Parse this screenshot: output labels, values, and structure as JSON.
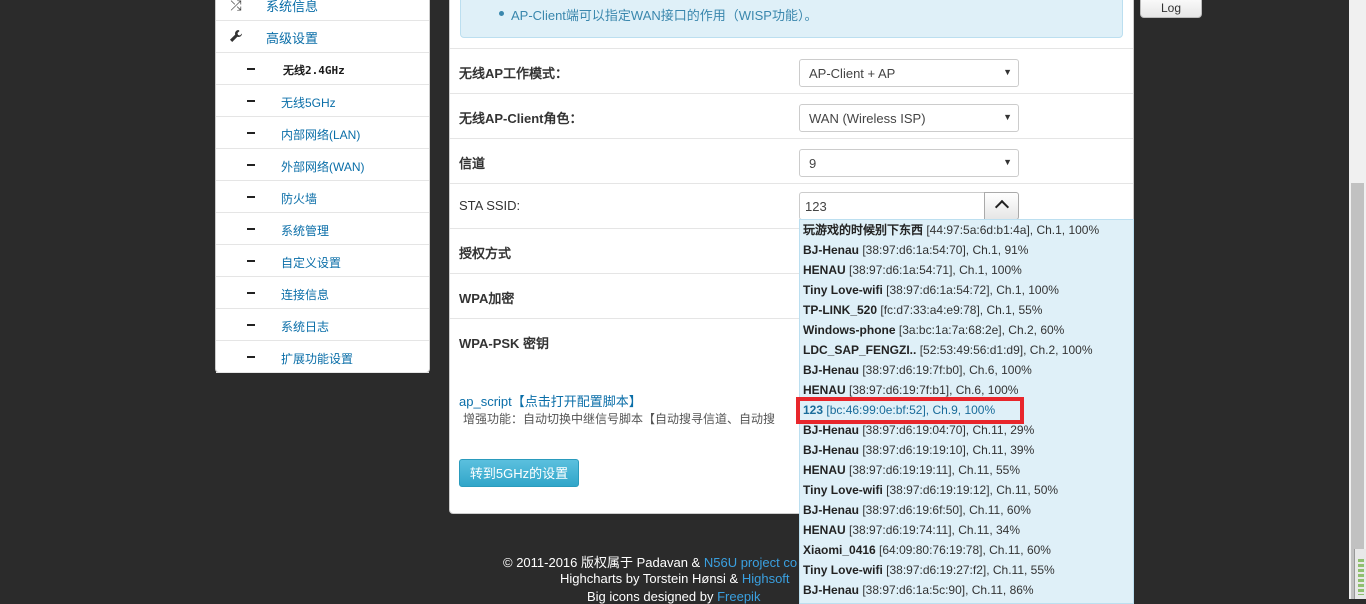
{
  "sidebar": {
    "top_items": [
      {
        "label": "系统信息",
        "icon": "shuffle-icon"
      },
      {
        "label": "高级设置",
        "icon": "wrench-icon"
      }
    ],
    "sub_items": [
      {
        "label": "无线2.4GHz",
        "active": true
      },
      {
        "label": "无线5GHz"
      },
      {
        "label": "内部网络(LAN)"
      },
      {
        "label": "外部网络(WAN)"
      },
      {
        "label": "防火墙"
      },
      {
        "label": "系统管理"
      },
      {
        "label": "自定义设置"
      },
      {
        "label": "连接信息"
      },
      {
        "label": "系统日志"
      },
      {
        "label": "扩展功能设置"
      }
    ]
  },
  "info": {
    "text": "AP-Client端可以指定WAN接口的作用（WISP功能）。"
  },
  "form": {
    "ap_mode": {
      "label": "无线AP工作模式：",
      "value": "AP-Client + AP"
    },
    "ap_client_role": {
      "label": "无线AP-Client角色：",
      "value": "WAN (Wireless ISP)"
    },
    "channel": {
      "label": "信道",
      "value": "9"
    },
    "sta_ssid": {
      "label": "STA SSID:",
      "value": "123"
    },
    "auth_mode": {
      "label": "授权方式"
    },
    "wpa_encrypt": {
      "label": "WPA加密"
    },
    "wpa_psk": {
      "label": "WPA-PSK 密钥"
    }
  },
  "script": {
    "link": "ap_script【点击打开配置脚本】",
    "desc": "增强功能：自动切换中继信号脚本【自动搜寻信道、自动搜"
  },
  "buttons": {
    "switch_5g": "转到5GHz的设置",
    "log": "Log"
  },
  "ssid_list": [
    {
      "ssid": "玩游戏的时候别下东西",
      "detail": " [44:97:5a:6d:b1:4a], Ch.1, 100%"
    },
    {
      "ssid": "BJ-Henau",
      "detail": " [38:97:d6:1a:54:70], Ch.1, 91%"
    },
    {
      "ssid": "HENAU",
      "detail": " [38:97:d6:1a:54:71], Ch.1, 100%"
    },
    {
      "ssid": "Tiny Love-wifi",
      "detail": " [38:97:d6:1a:54:72], Ch.1, 100%"
    },
    {
      "ssid": "TP-LINK_520",
      "detail": " [fc:d7:33:a4:e9:78], Ch.1, 55%"
    },
    {
      "ssid": "Windows-phone",
      "detail": " [3a:bc:1a:7a:68:2e], Ch.2, 60%"
    },
    {
      "ssid": "LDC_SAP_FENGZI..",
      "detail": " [52:53:49:56:d1:d9], Ch.2, 100%"
    },
    {
      "ssid": "BJ-Henau",
      "detail": " [38:97:d6:19:7f:b0], Ch.6, 100%"
    },
    {
      "ssid": "HENAU",
      "detail": " [38:97:d6:19:7f:b1], Ch.6, 100%"
    },
    {
      "ssid": "123",
      "detail": " [bc:46:99:0e:bf:52], Ch.9, 100%",
      "selected": true
    },
    {
      "ssid": "BJ-Henau",
      "detail": " [38:97:d6:19:04:70], Ch.11, 29%"
    },
    {
      "ssid": "BJ-Henau",
      "detail": " [38:97:d6:19:19:10], Ch.11, 39%"
    },
    {
      "ssid": "HENAU",
      "detail": " [38:97:d6:19:19:11], Ch.11, 55%"
    },
    {
      "ssid": "Tiny Love-wifi",
      "detail": " [38:97:d6:19:19:12], Ch.11, 50%"
    },
    {
      "ssid": "BJ-Henau",
      "detail": " [38:97:d6:19:6f:50], Ch.11, 60%"
    },
    {
      "ssid": "HENAU",
      "detail": " [38:97:d6:19:74:11], Ch.11, 34%"
    },
    {
      "ssid": "Xiaomi_0416",
      "detail": " [64:09:80:76:19:78], Ch.11, 60%"
    },
    {
      "ssid": "Tiny Love-wifi",
      "detail": " [38:97:d6:19:27:f2], Ch.11, 55%"
    },
    {
      "ssid": "BJ-Henau",
      "detail": " [38:97:d6:1a:5c:90], Ch.11, 86%"
    }
  ],
  "footer": {
    "line1_prefix": "© 2011-2016 版权属于 Padavan & ",
    "line1_link": "N56U project co",
    "line2_prefix": "Highcharts by Torstein Hønsi & ",
    "line2_link": "Highsoft",
    "line3_prefix": "Big icons designed by ",
    "line3_link": "Freepik"
  },
  "colors": {
    "accent": "#0a6ea8",
    "info_bg": "#dff0f8",
    "button": "#31a6c9",
    "highlight": "#e8262b"
  }
}
